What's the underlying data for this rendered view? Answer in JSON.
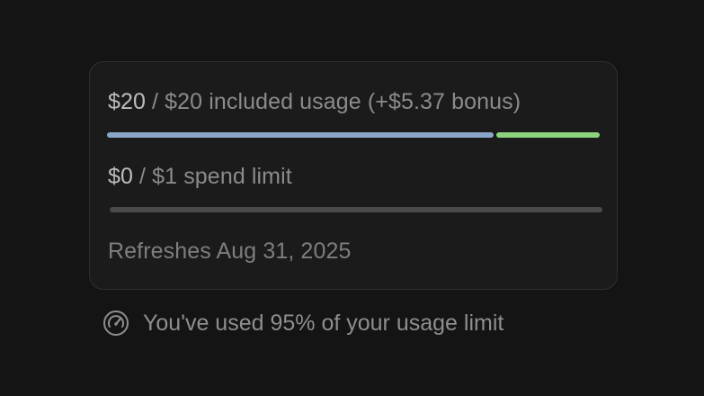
{
  "usage_card": {
    "included": {
      "used": "$20",
      "rest": " / $20 included usage (+$5.37 bonus)",
      "used_fraction": 0.785,
      "bonus_fraction": 0.215,
      "colors": {
        "used": "#8aa6c8",
        "bonus": "#8bd37c"
      }
    },
    "spend": {
      "used": "$0",
      "rest": " / $1 spend limit",
      "used_fraction": 0.0,
      "track_color": "#4a4a4a"
    },
    "refresh_text": "Refreshes Aug 31, 2025"
  },
  "footer": {
    "icon": "gauge-icon",
    "text": "You've used 95% of your usage limit"
  }
}
